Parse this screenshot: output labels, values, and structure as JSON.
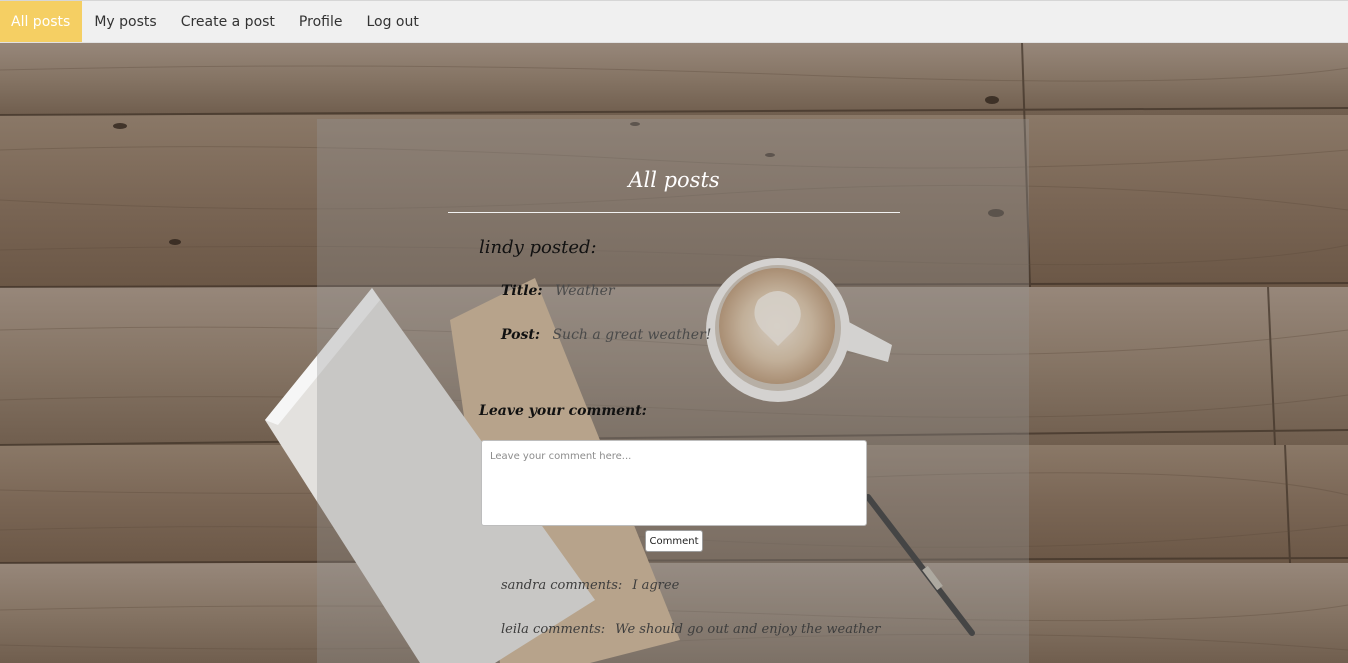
{
  "nav": {
    "items": [
      {
        "label": "All posts",
        "active": true
      },
      {
        "label": "My posts",
        "active": false
      },
      {
        "label": "Create a post",
        "active": false
      },
      {
        "label": "Profile",
        "active": false
      },
      {
        "label": "Log out",
        "active": false
      }
    ]
  },
  "page": {
    "title": "All posts"
  },
  "post": {
    "author_line": "lindy posted:",
    "title_label": "Title:",
    "title_value": "Weather",
    "post_label": "Post:",
    "post_value": "Such a great weather!"
  },
  "comment_form": {
    "heading": "Leave your comment:",
    "placeholder": "Leave your comment here...",
    "button_label": "Comment"
  },
  "comments": [
    {
      "author": "sandra comments:",
      "text": "I agree"
    },
    {
      "author": "leila comments:",
      "text": "We should go out and enjoy the weather"
    }
  ],
  "colors": {
    "nav_active_bg": "#f5cf63",
    "nav_bg": "#f0f0f0",
    "panel_overlay": "rgba(150,150,150,0.34)"
  }
}
